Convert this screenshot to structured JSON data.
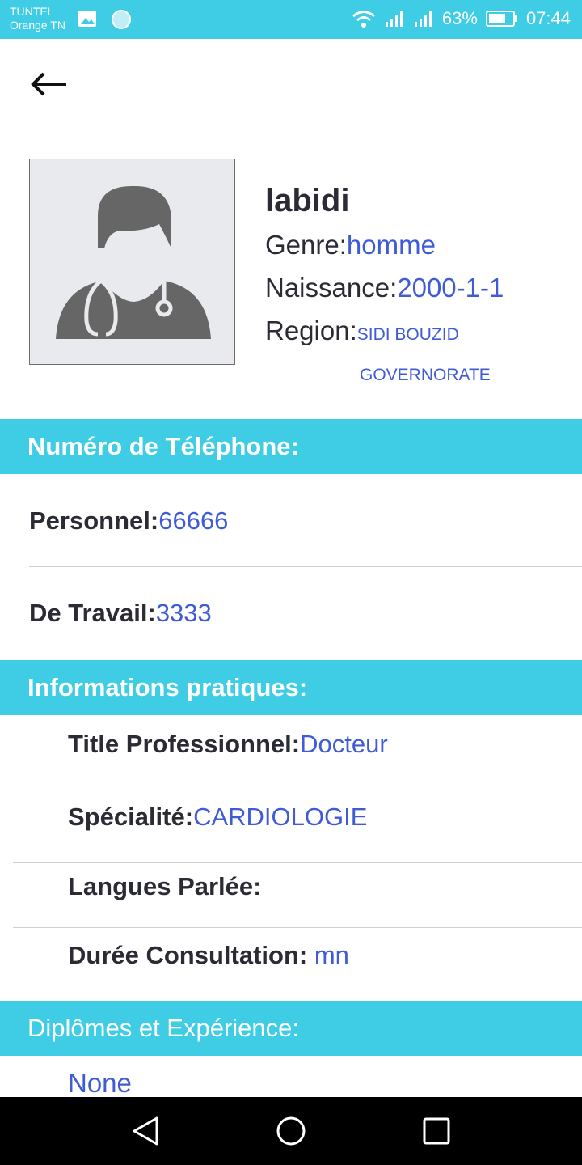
{
  "status": {
    "carrier_line1": "TUNTEL",
    "carrier_line2": "Orange TN",
    "battery": "63%",
    "time": "07:44"
  },
  "profile": {
    "name": "labidi",
    "genre_label": "Genre:",
    "genre_value": "homme",
    "birth_label": "Naissance:",
    "birth_value": "2000-1-1",
    "region_label": "Region:",
    "region_value_line1": "SIDI BOUZID",
    "region_value_line2": "GOVERNORATE"
  },
  "phone_section": {
    "title": "Numéro de Téléphone:",
    "personal_label": "Personnel:",
    "personal_value": "66666",
    "work_label": "De Travail:",
    "work_value": "3333"
  },
  "practical_section": {
    "title": "Informations pratiques:",
    "title_label": "Title Professionnel:",
    "title_value": "Docteur",
    "specialty_label": "Spécialité:",
    "specialty_value": "CARDIOLOGIE",
    "languages_label": "Langues Parlée:",
    "duration_label": "Durée Consultation:",
    "duration_value": " mn"
  },
  "diploma_section": {
    "title": "Diplômes et Expérience:",
    "value": "None"
  },
  "colors": {
    "accent": "#3fcde6",
    "value_blue": "#3f5bd6",
    "text_dark": "#2b2b36"
  },
  "icons": [
    "back-arrow-icon",
    "doctor-avatar-icon",
    "wifi-icon",
    "signal-icon",
    "battery-icon",
    "image-icon",
    "nav-back-icon",
    "nav-home-icon",
    "nav-recents-icon"
  ]
}
